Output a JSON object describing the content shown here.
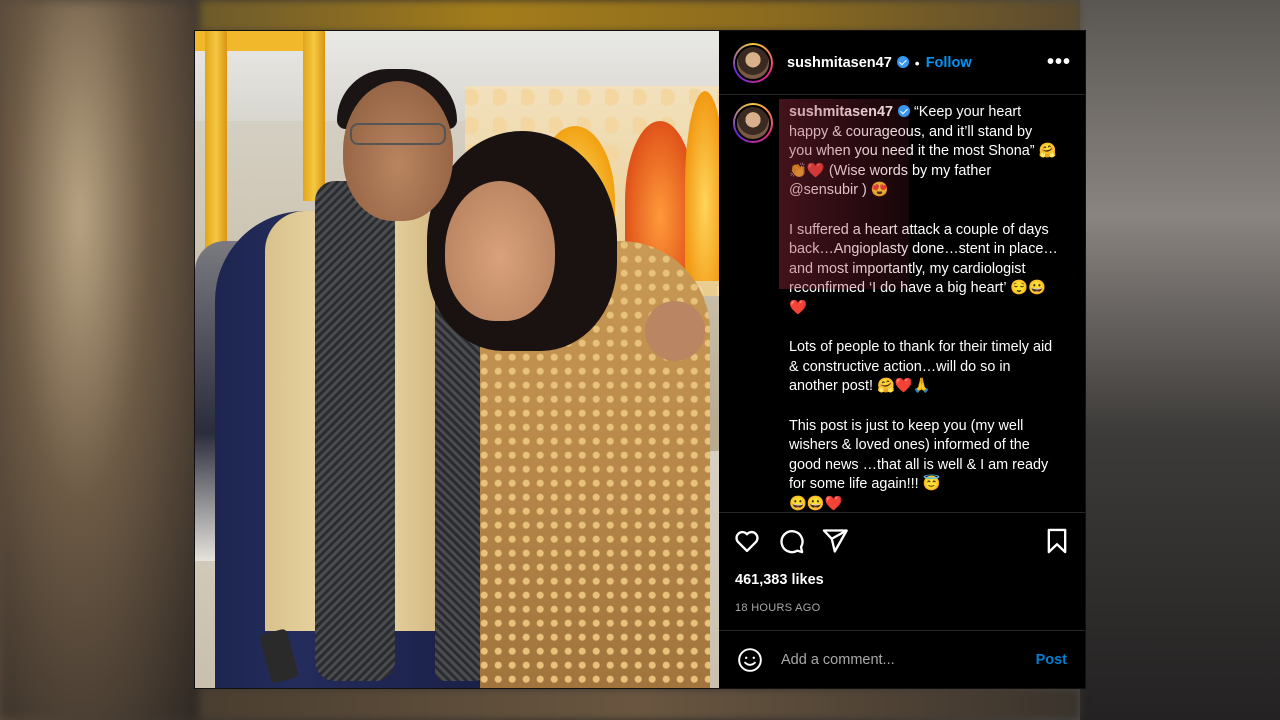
{
  "post": {
    "username": "sushmitasen47",
    "follow_label": "Follow",
    "more_icon": "more-horizontal-icon",
    "caption": {
      "username": "sushmitasen47",
      "text": " “Keep your heart happy & courageous, and it’ll stand by you when you need it the most Shona” 🤗👏❤️ (Wise words by my father @sensubir ) 😍\n\nI suffered a heart attack a couple of days back…Angioplasty done…stent in place…and most importantly, my cardiologist reconfirmed ‘I do have a big heart’ 😌😀❤️\n\nLots of people to thank for their timely aid & constructive action…will do so in another post! 🤗❤️🙏\n\nThis post is just to keep you (my well wishers & loved ones) informed of the good news …that all is well & I am ready for some life again!!! 😇\n😀😀❤️"
    },
    "likes": "461,383 likes",
    "timestamp": "18 HOURS AGO",
    "comment_placeholder": "Add a comment...",
    "post_button": "Post",
    "icons": {
      "like": "heart-icon",
      "comment": "comment-icon",
      "share": "send-icon",
      "save": "bookmark-icon",
      "emoji": "emoji-icon"
    },
    "colors": {
      "link_blue": "#0095f6",
      "background": "#000000",
      "text": "#ffffff",
      "muted": "#a8a8a8"
    }
  }
}
